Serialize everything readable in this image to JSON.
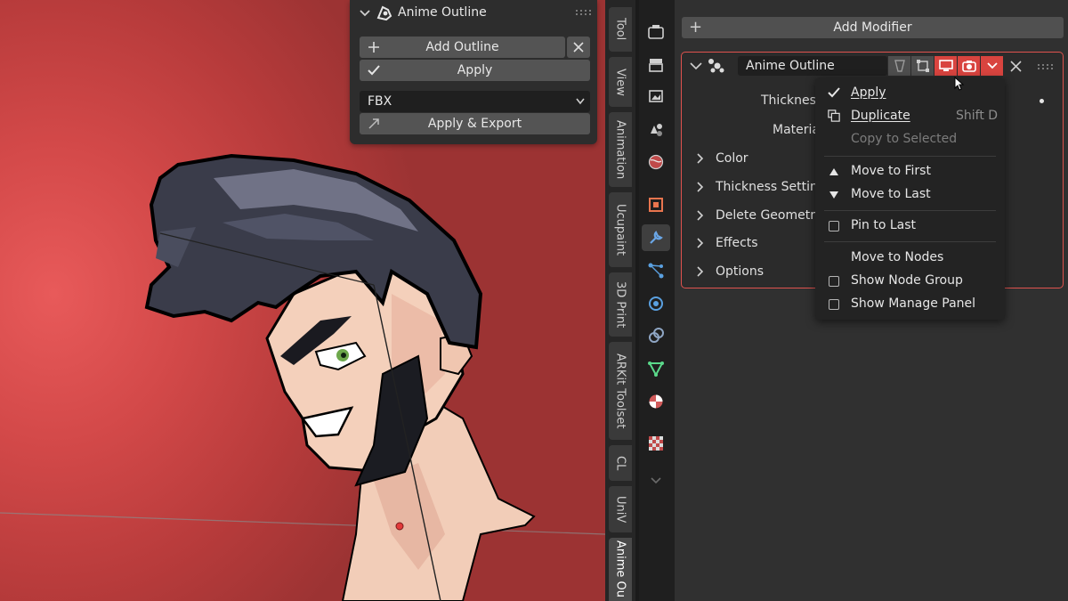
{
  "npanel": {
    "title": "Anime Outline",
    "add_outline": "Add Outline",
    "apply": "Apply",
    "format": "FBX",
    "apply_export": "Apply & Export"
  },
  "vtabs": [
    "Tool",
    "View",
    "Animation",
    "Ucupaint",
    "3D Print",
    "ARKit Toolset",
    "CL",
    "UniV",
    "Anime Ou"
  ],
  "properties": {
    "add_modifier": "Add Modifier",
    "modifier_name": "Anime Outline",
    "rows": [
      "Thickness",
      "Materia"
    ],
    "subpanels": [
      "Color",
      "Thickness Settings",
      "Delete Geometry",
      "Effects",
      "Options"
    ]
  },
  "context_menu": {
    "items": [
      {
        "label": "Apply",
        "icon": "check-icon",
        "shortcut": "",
        "disabled": false
      },
      {
        "label": "Duplicate",
        "icon": "duplicate-icon",
        "shortcut": "Shift D",
        "disabled": false
      },
      {
        "label": "Copy to Selected",
        "icon": "",
        "shortcut": "",
        "disabled": true
      },
      {
        "label": "Move to First",
        "icon": "triangle-up-icon",
        "shortcut": "",
        "disabled": false
      },
      {
        "label": "Move to Last",
        "icon": "triangle-down-icon",
        "shortcut": "",
        "disabled": false
      },
      {
        "label": "Pin to Last",
        "icon": "checkbox-icon",
        "shortcut": "",
        "disabled": false
      },
      {
        "label": "Move to Nodes",
        "icon": "",
        "shortcut": "",
        "disabled": false
      },
      {
        "label": "Show Node Group",
        "icon": "checkbox-icon",
        "shortcut": "",
        "disabled": false
      },
      {
        "label": "Show Manage Panel",
        "icon": "checkbox-icon",
        "shortcut": "",
        "disabled": false
      }
    ]
  },
  "colors": {
    "accent_red": "#d9443f",
    "panel_border": "#e0524e",
    "viewport_bg": "#d34949"
  }
}
